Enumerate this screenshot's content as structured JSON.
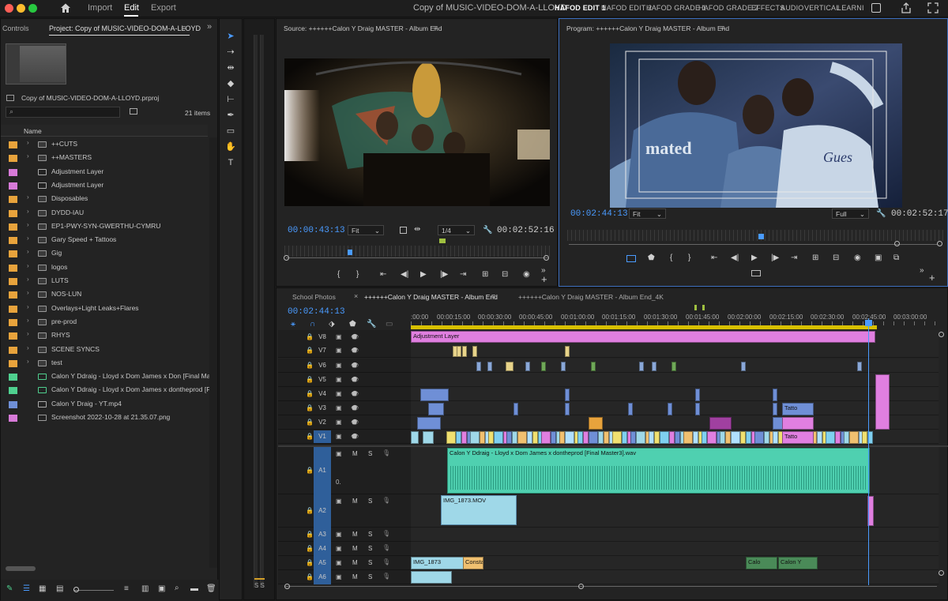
{
  "app": {
    "home_icon": "home-icon",
    "nav": [
      "Import",
      "Edit",
      "Export"
    ],
    "active_nav": "Edit",
    "title": "Copy of MUSIC-VIDEO-DOM-A-LLOYD",
    "workspaces": [
      "HAFOD EDIT 1",
      "HAFOD EDIT 2",
      "HAFOD GRADE 1",
      "HAFOD GRADE 2",
      "EFFECTS",
      "AUDIO",
      "VERTICAL",
      "LEARNING"
    ],
    "active_workspace": "HAFOD EDIT 1"
  },
  "project": {
    "tab_controls": "Controls",
    "tab_project": "Project: Copy of MUSIC-VIDEO-DOM-A-LLOYD",
    "file": "Copy of MUSIC-VIDEO-DOM-A-LLOYD.prproj",
    "item_count": "21 items",
    "column_name": "Name",
    "items": [
      {
        "name": "++CUTS",
        "type": "folder",
        "color": "#e8a33c"
      },
      {
        "name": "++MASTERS",
        "type": "folder",
        "color": "#e8a33c"
      },
      {
        "name": "Adjustment Layer",
        "type": "adjust",
        "color": "#d77ad8"
      },
      {
        "name": "Adjustment Layer",
        "type": "adjust",
        "color": "#d77ad8"
      },
      {
        "name": "Disposables",
        "type": "folder",
        "color": "#e8a33c"
      },
      {
        "name": "DYDD-IAU",
        "type": "folder",
        "color": "#e8a33c"
      },
      {
        "name": "EP1-PWY-SYN-GWERTHU-CYMRU",
        "type": "folder",
        "color": "#e8a33c"
      },
      {
        "name": "Gary Speed + Tattoos",
        "type": "folder",
        "color": "#e8a33c"
      },
      {
        "name": "Gig",
        "type": "folder",
        "color": "#e8a33c"
      },
      {
        "name": "logos",
        "type": "folder",
        "color": "#e8a33c"
      },
      {
        "name": "LUTS",
        "type": "folder",
        "color": "#e8a33c"
      },
      {
        "name": "NOS-LUN",
        "type": "folder",
        "color": "#e8a33c"
      },
      {
        "name": "Overlays+Light Leaks+Flares",
        "type": "folder",
        "color": "#e8a33c"
      },
      {
        "name": "pre-prod",
        "type": "folder",
        "color": "#e8a33c"
      },
      {
        "name": "RHYS",
        "type": "folder",
        "color": "#e8a33c"
      },
      {
        "name": "SCENE SYNCS",
        "type": "folder",
        "color": "#e8a33c"
      },
      {
        "name": "test",
        "type": "folder",
        "color": "#e8a33c"
      },
      {
        "name": "Calon Y Ddraig - Lloyd x Dom James x Don [Final Master",
        "type": "audio",
        "color": "#4fd08f"
      },
      {
        "name": "Calon Y Ddraig - Lloyd x Dom James x dontheprod [Final",
        "type": "audio",
        "color": "#4fd08f"
      },
      {
        "name": "Calon Y Draig - YT.mp4",
        "type": "video",
        "color": "#6f8fd6"
      },
      {
        "name": "Screenshot 2022-10-28 at 21.35.07.png",
        "type": "image",
        "color": "#d77ad8"
      }
    ]
  },
  "source": {
    "title": "Source: ++++++Calon Y Draig MASTER - Album End",
    "timecode": "00:00:43:13",
    "fit": "Fit",
    "res": "1/4",
    "duration": "00:02:52:16"
  },
  "program": {
    "title": "Program: ++++++Calon Y Draig MASTER - Album End",
    "timecode": "00:02:44:13",
    "fit": "Fit",
    "res": "Full",
    "duration": "00:02:52:17"
  },
  "timeline": {
    "tabs": [
      "School Photos",
      "++++++Calon Y Draig MASTER - Album End",
      "++++++Calon Y Draig MASTER - Album End_4K"
    ],
    "active_tab": "++++++Calon Y Draig MASTER - Album End",
    "timecode": "00:02:44:13",
    "ruler": [
      ":00:00",
      "00:00:15:00",
      "00:00:30:00",
      "00:00:45:00",
      "00:01:00:00",
      "00:01:15:00",
      "00:01:30:00",
      "00:01:45:00",
      "00:02:00:00",
      "00:02:15:00",
      "00:02:30:00",
      "00:02:45:00",
      "00:03:00:00"
    ],
    "video_tracks": [
      "V8",
      "V7",
      "V6",
      "V5",
      "V4",
      "V3",
      "V2",
      "V1"
    ],
    "audio_tracks": [
      "A1",
      "A2",
      "A3",
      "A4",
      "A5",
      "A6"
    ],
    "track_m": "M",
    "track_s": "S",
    "a1_level": "0.",
    "clips": {
      "adjustment": "Adjustment Layer",
      "audio_main": "Calon Y Ddraig - Lloyd x Dom James x dontheprod [Final Master3].wav",
      "a2_clip": "IMG_1873.MOV",
      "a5_clip1": "IMG_1873",
      "a5_clip2": "Constan",
      "a5_clip3": "Calo",
      "a5_clip4": "Calon Y",
      "v3_tatto": "Tatto",
      "v1_tatto": "Tatto",
      "fx": "fx"
    },
    "meter_label": "S S"
  }
}
